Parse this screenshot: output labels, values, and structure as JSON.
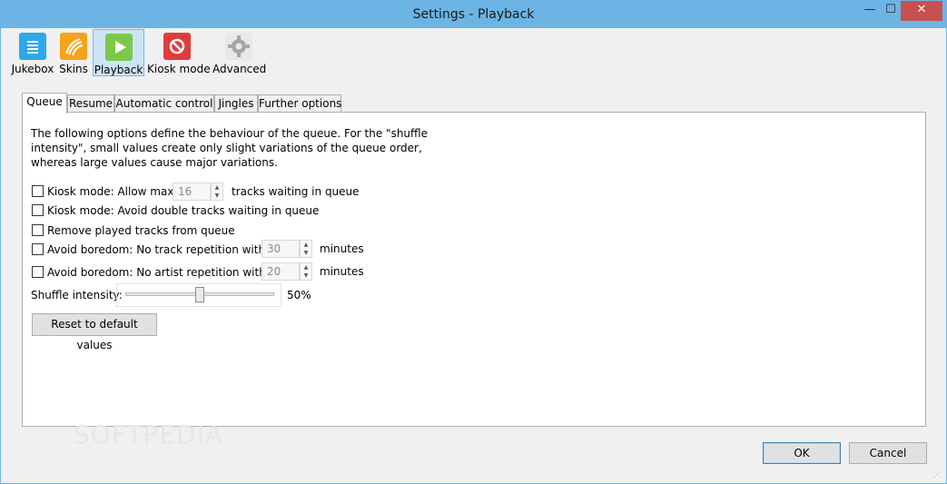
{
  "window": {
    "title": "Settings - Playback",
    "minimize_glyph": "—",
    "maximize_glyph": "☐",
    "close_glyph": "✕"
  },
  "toolbar": {
    "items": [
      {
        "label": "Jukebox",
        "icon": "jukebox-icon",
        "color": "#2da8e8"
      },
      {
        "label": "Skins",
        "icon": "skins-icon",
        "color": "#f5a31a"
      },
      {
        "label": "Playback",
        "icon": "playback-icon",
        "color": "#7cc84a"
      },
      {
        "label": "Kiosk mode",
        "icon": "kiosk-icon",
        "color": "#e03c3c"
      },
      {
        "label": "Advanced",
        "icon": "advanced-gear-icon",
        "color": "#b5b5b5"
      }
    ],
    "active": "Playback"
  },
  "tabs": [
    "Queue",
    "Resume",
    "Automatic control",
    "Jingles",
    "Further options"
  ],
  "active_tab": "Queue",
  "queue": {
    "description": "The following options define the behaviour of the queue. For the \"shuffle intensity\", small values create only slight variations of the queue order, whereas large values cause major variations.",
    "kiosk_max_label": "Kiosk mode: Allow max.",
    "kiosk_max_value": "16",
    "kiosk_max_suffix": "tracks waiting in queue",
    "kiosk_double_label": "Kiosk mode: Avoid double tracks waiting in queue",
    "remove_played_label": "Remove played tracks from queue",
    "no_track_rep_label": "Avoid boredom: No track repetition within",
    "no_track_rep_value": "30",
    "no_track_rep_suffix": "minutes",
    "no_artist_rep_label": "Avoid boredom: No artist repetition within",
    "no_artist_rep_value": "20",
    "no_artist_rep_suffix": "minutes",
    "shuffle_label": "Shuffle intensity:",
    "shuffle_value_text": "50%",
    "shuffle_value": 0.5,
    "reset_label": "Reset to default values"
  },
  "footer": {
    "ok_label": "OK",
    "cancel_label": "Cancel"
  },
  "watermark": "SOFTPEDIA"
}
